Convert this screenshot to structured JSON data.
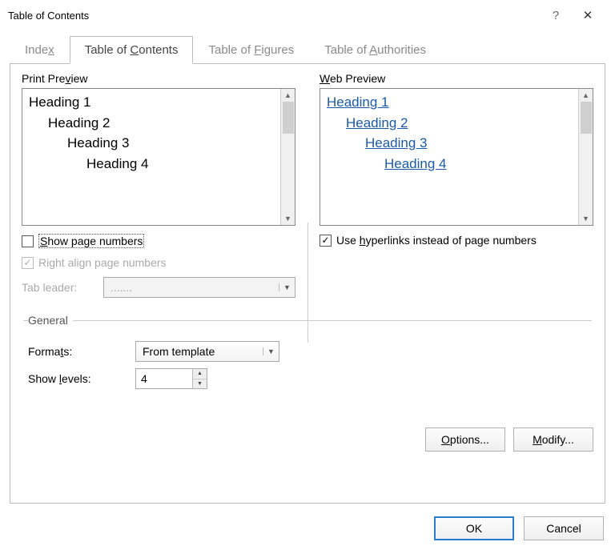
{
  "title": "Table of Contents",
  "tabs": {
    "index": "Index",
    "toc": "Table of Contents",
    "tof": "Table of Figures",
    "toa": "Table of Authorities"
  },
  "preview": {
    "print_label": "Print Preview",
    "web_label": "Web Preview",
    "items": {
      "h1": "Heading 1",
      "h2": "Heading 2",
      "h3": "Heading 3",
      "h4": "Heading 4"
    }
  },
  "options": {
    "show_page_numbers_label": "Show page numbers",
    "show_page_numbers_checked": false,
    "right_align_label": "Right align page numbers",
    "right_align_checked": true,
    "right_align_disabled": true,
    "tab_leader_label": "Tab leader:",
    "tab_leader_value": ".......",
    "use_hyperlinks_label": "Use hyperlinks instead of page numbers",
    "use_hyperlinks_checked": true
  },
  "general": {
    "legend": "General",
    "formats_label": "Formats:",
    "formats_value": "From template",
    "levels_label": "Show levels:",
    "levels_value": "4"
  },
  "buttons": {
    "options": "Options...",
    "modify": "Modify...",
    "ok": "OK",
    "cancel": "Cancel"
  }
}
